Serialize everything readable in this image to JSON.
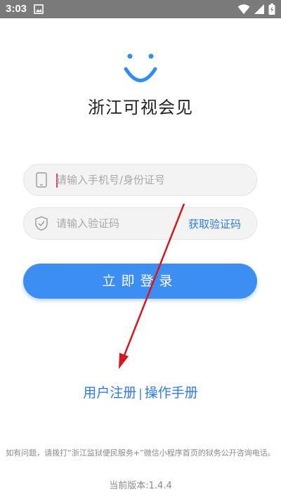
{
  "status_bar": {
    "time": "3:03"
  },
  "app": {
    "title": "浙江可视会见"
  },
  "login": {
    "phone_placeholder": "请输入手机号/身份证号",
    "code_placeholder": "请输入验证码",
    "get_code_label": "获取验证码",
    "submit_label": "立即登录"
  },
  "links": {
    "register_label": "用户注册",
    "separator": "|",
    "manual_label": "操作手册"
  },
  "footer": {
    "note": "如有问题，请拨打“浙江监狱便民服务+”微信小程序首页的狱务公开咨询电话。",
    "version": "当前版本:1.4.4"
  },
  "colors": {
    "accent": "#3d8ef2",
    "link": "#2f7be8",
    "status_bar": "#7a7a7a",
    "annotation": "#d9161b"
  }
}
